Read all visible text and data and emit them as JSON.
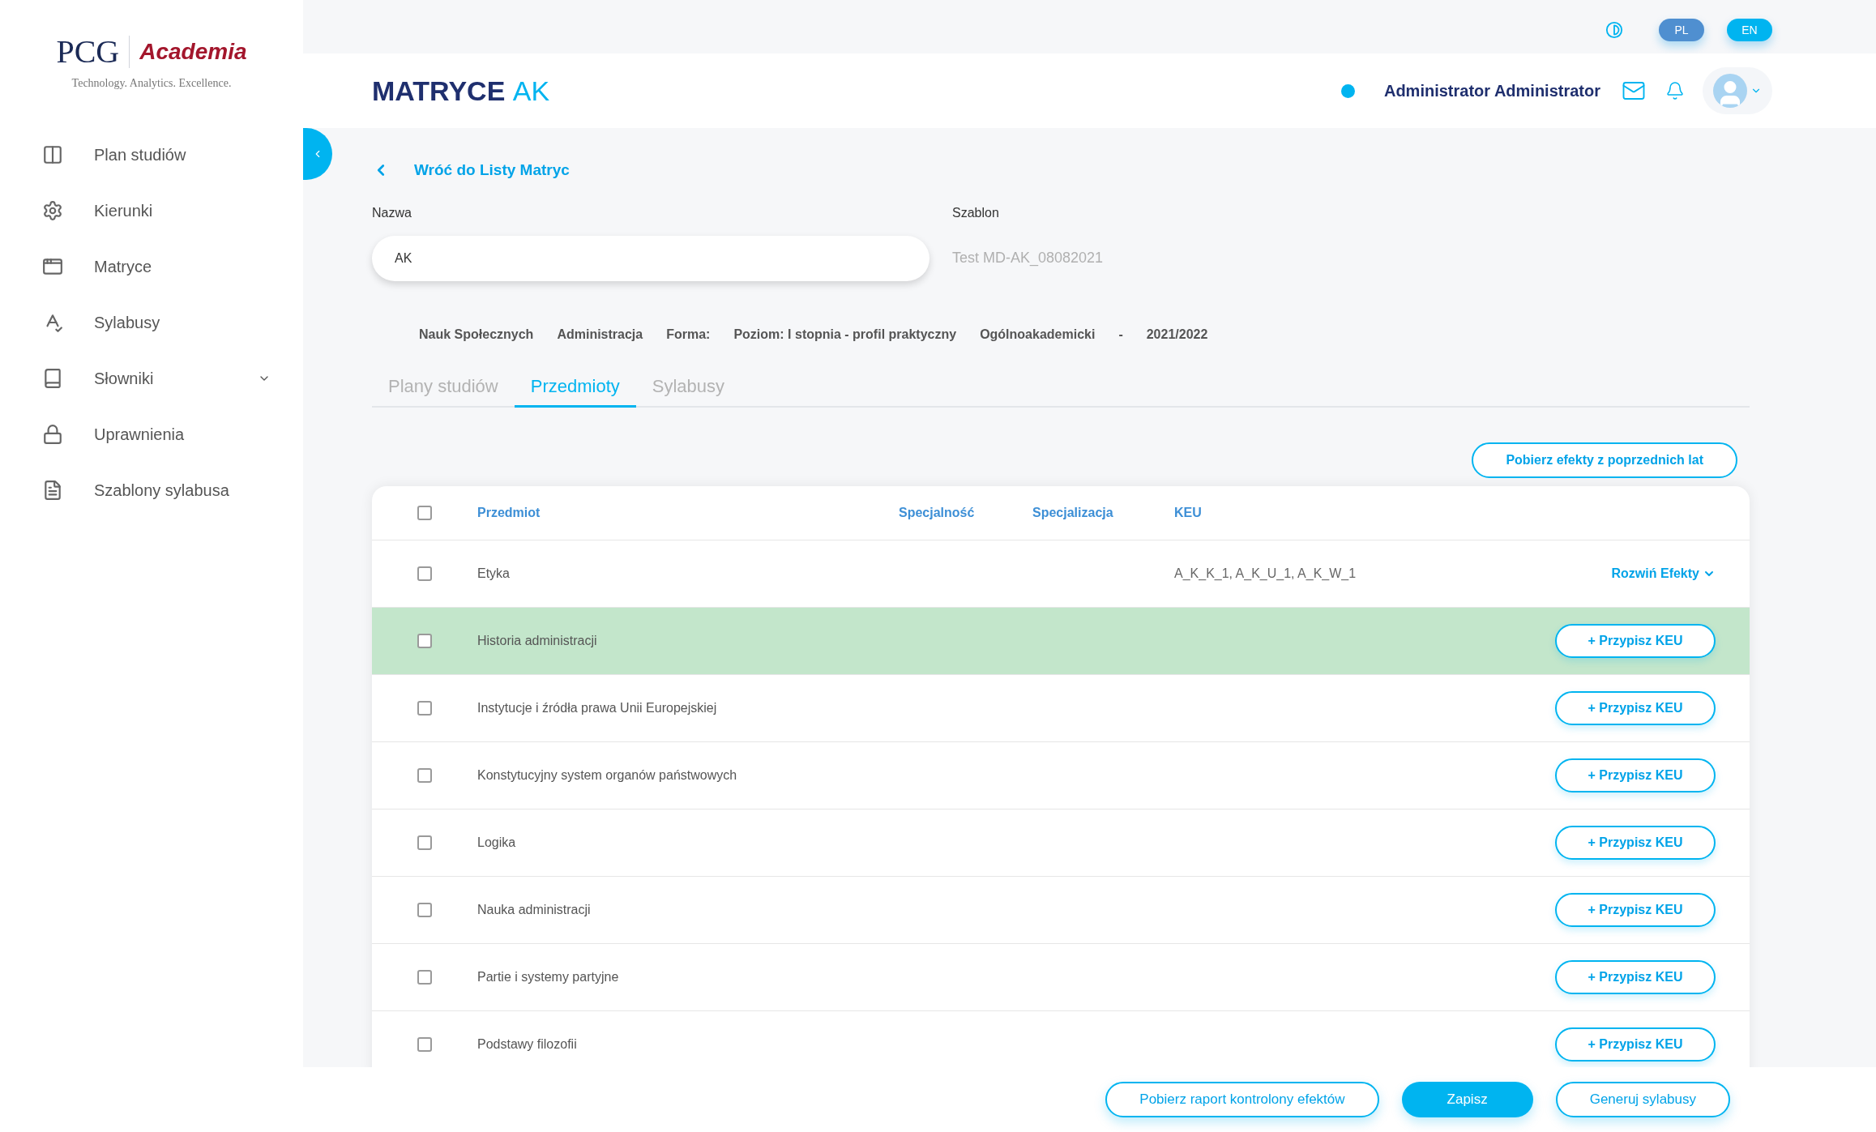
{
  "logo": {
    "brand": "PCG",
    "product": "Academia",
    "tagline": "Technology. Analytics. Excellence."
  },
  "sidebar": {
    "items": [
      {
        "label": "Plan studiów",
        "has_submenu": false
      },
      {
        "label": "Kierunki",
        "has_submenu": false
      },
      {
        "label": "Matryce",
        "has_submenu": false
      },
      {
        "label": "Sylabusy",
        "has_submenu": false
      },
      {
        "label": "Słowniki",
        "has_submenu": true
      },
      {
        "label": "Uprawnienia",
        "has_submenu": false
      },
      {
        "label": "Szablony sylabusa",
        "has_submenu": false
      }
    ]
  },
  "languages": [
    {
      "label": "PL",
      "selected": true
    },
    {
      "label": "EN",
      "selected": false
    }
  ],
  "header": {
    "title": "MATRYCE",
    "title_suffix": "AK",
    "user": "Administrator Administrator"
  },
  "back_link": "Wróć do Listy Matryc",
  "fields": {
    "name": {
      "label": "Nazwa",
      "value": "AK"
    },
    "template": {
      "label": "Szablon",
      "value": "Test MD-AK_08082021"
    }
  },
  "info": [
    "Nauk Społecznych",
    "Administracja",
    "Forma:",
    "Poziom: I stopnia - profil praktyczny",
    "Ogólnoakademicki",
    "-",
    "2021/2022"
  ],
  "tabs": [
    {
      "label": "Plany studiów",
      "selected": false
    },
    {
      "label": "Przedmioty",
      "selected": true
    },
    {
      "label": "Sylabusy",
      "selected": false
    }
  ],
  "fetch_button": "Pobierz efekty z poprzednich lat",
  "table": {
    "select_all_checked": false,
    "columns": [
      "Przedmiot",
      "Specjalność",
      "Specjalizacja",
      "KEU"
    ],
    "rows": [
      {
        "name": "Etyka",
        "keu": "A_K_K_1, A_K_U_1, A_K_W_1",
        "kind": "expand",
        "action": "Rozwiń Efekty",
        "checked": false,
        "highlighted": false
      },
      {
        "name": "Historia administracji",
        "kind": "assign",
        "action": "+ Przypisz KEU",
        "checked": false,
        "highlighted": true
      },
      {
        "name": "Instytucje i źródła prawa Unii Europejskiej",
        "kind": "assign",
        "action": "+ Przypisz KEU",
        "checked": false,
        "highlighted": false
      },
      {
        "name": "Konstytucyjny system organów państwowych",
        "kind": "assign",
        "action": "+ Przypisz KEU",
        "checked": false,
        "highlighted": false
      },
      {
        "name": "Logika",
        "kind": "assign",
        "action": "+ Przypisz KEU",
        "checked": false,
        "highlighted": false
      },
      {
        "name": "Nauka administracji",
        "kind": "assign",
        "action": "+ Przypisz KEU",
        "checked": false,
        "highlighted": false
      },
      {
        "name": "Partie i systemy partyjne",
        "kind": "assign",
        "action": "+ Przypisz KEU",
        "checked": false,
        "highlighted": false
      },
      {
        "name": "Podstawy filozofii",
        "kind": "assign",
        "action": "+ Przypisz KEU",
        "checked": false,
        "highlighted": false
      }
    ]
  },
  "footer": [
    {
      "label": "Pobierz raport kontrolony efektów",
      "kind": "outline"
    },
    {
      "label": "Zapisz",
      "kind": "primary"
    },
    {
      "label": "Generuj sylabusy",
      "kind": "outline"
    }
  ]
}
